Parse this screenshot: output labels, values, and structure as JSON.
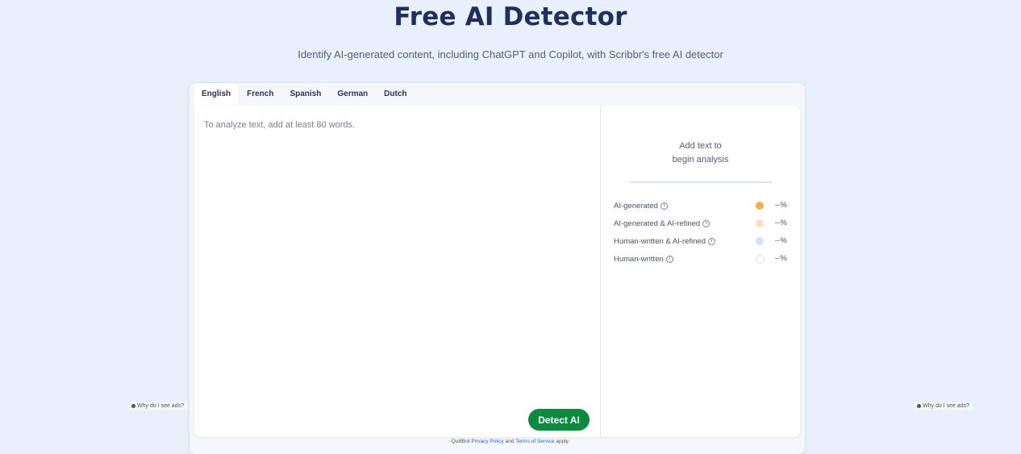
{
  "header": {
    "title": "Free AI Detector",
    "subtitle": "Identify AI-generated content, including ChatGPT and Copilot, with Scribbr's free AI detector"
  },
  "tabs": [
    {
      "label": "English",
      "active": true
    },
    {
      "label": "French",
      "active": false
    },
    {
      "label": "Spanish",
      "active": false
    },
    {
      "label": "German",
      "active": false
    },
    {
      "label": "Dutch",
      "active": false
    }
  ],
  "editor": {
    "placeholder": "To analyze text, add at least 80 words.",
    "value": "",
    "detect_label": "Detect AI",
    "detect_color": "#0c8a3f"
  },
  "results": {
    "placeholder_line1": "Add text to",
    "placeholder_line2": "begin analysis",
    "legend": [
      {
        "label": "AI-generated",
        "value": "--%",
        "color": "#f7ad55"
      },
      {
        "label": "AI-generated & AI-refined",
        "value": "--%",
        "color": "#fbe0c6"
      },
      {
        "label": "Human-written & AI-refined",
        "value": "--%",
        "color": "#d3e2f6"
      },
      {
        "label": "Human-written",
        "value": "--%",
        "color": "#ffffff"
      }
    ]
  },
  "ads": {
    "note": "Why do I see ads?"
  },
  "footer": {
    "prefix": "QuillBot",
    "privacy": "Privacy Policy",
    "and": "and",
    "terms": "Terms of Service",
    "suffix": "apply."
  }
}
